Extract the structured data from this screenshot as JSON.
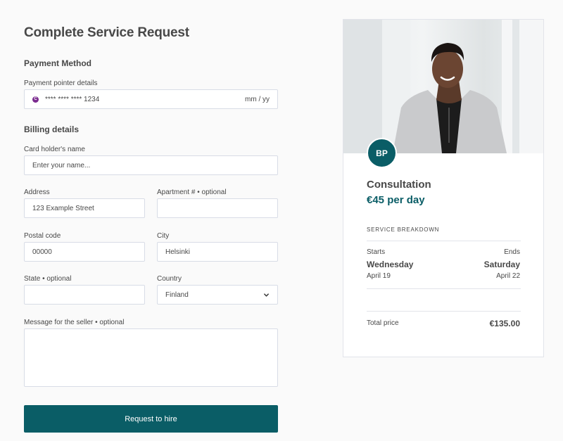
{
  "page": {
    "title": "Complete Service Request"
  },
  "payment": {
    "section_title": "Payment Method",
    "pointer_label": "Payment pointer details",
    "card_badge": "C",
    "card_number": "**** **** **** 1234",
    "expiry_placeholder": "mm / yy"
  },
  "billing": {
    "section_title": "Billing details",
    "name_label": "Card holder's name",
    "name_placeholder": "Enter your name...",
    "address_label": "Address",
    "address_value": "123 Example Street",
    "apartment_label": "Apartment # • optional",
    "apartment_value": "",
    "postal_label": "Postal code",
    "postal_value": "00000",
    "city_label": "City",
    "city_value": "Helsinki",
    "state_label": "State • optional",
    "state_value": "",
    "country_label": "Country",
    "country_value": "Finland",
    "message_label": "Message for the seller • optional",
    "message_value": ""
  },
  "actions": {
    "submit_label": "Request to hire"
  },
  "listing": {
    "avatar_initials": "BP",
    "title": "Consultation",
    "price_per_day": "€45 per day",
    "breakdown_title": "SERVICE BREAKDOWN",
    "starts_label": "Starts",
    "ends_label": "Ends",
    "start_day": "Wednesday",
    "end_day": "Saturday",
    "start_date": "April 19",
    "end_date": "April 22",
    "total_label": "Total price",
    "total_value": "€135.00"
  },
  "colors": {
    "accent": "#0a5d66",
    "card_badge": "#7b2b8f"
  },
  "icons": {
    "country_dropdown": "chevron-down-icon",
    "card": "card-brand-icon"
  }
}
